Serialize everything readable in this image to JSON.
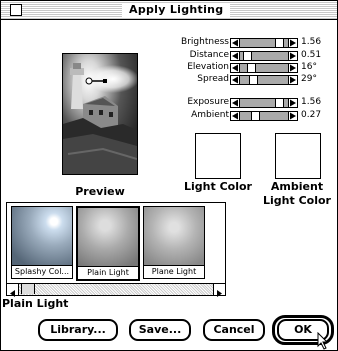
{
  "window": {
    "title": "Apply Lighting"
  },
  "preview": {
    "label": "Preview"
  },
  "sliders": [
    {
      "name": "Brightness",
      "value": "1.56",
      "level": 0.85
    },
    {
      "name": "Distance",
      "value": "0.51",
      "level": 0.08
    },
    {
      "name": "Elevation",
      "value": "16°",
      "level": 0.17
    },
    {
      "name": "Spread",
      "value": "29°",
      "level": 0.22
    },
    {
      "name": "Exposure",
      "value": "1.56",
      "level": 0.85
    },
    {
      "name": "Ambient",
      "value": "0.27",
      "level": 0.27
    }
  ],
  "light_color": {
    "label": "Light Color"
  },
  "ambient_light_color": {
    "label": "Ambient Light Color"
  },
  "library": {
    "items": [
      {
        "label": "Splashy Col..."
      },
      {
        "label": "Plain Light"
      },
      {
        "label": "Plane Light"
      }
    ],
    "selected_name": "Plain Light"
  },
  "buttons": {
    "library": "Library...",
    "save": "Save...",
    "cancel": "Cancel",
    "ok": "OK"
  }
}
